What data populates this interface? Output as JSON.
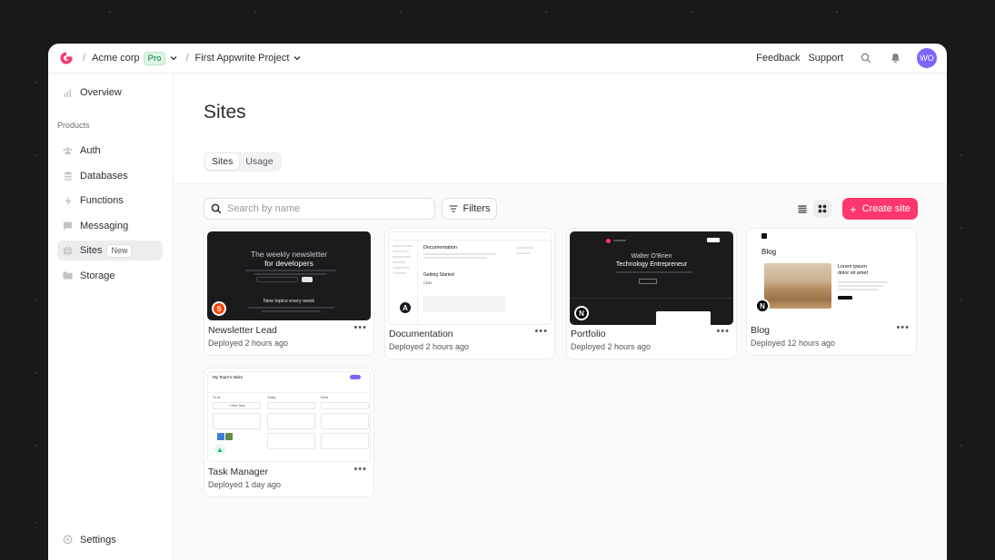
{
  "header": {
    "org_name": "Acme corp",
    "org_plan": "Pro",
    "project_name": "First Appwrite Project",
    "feedback_label": "Feedback",
    "support_label": "Support",
    "avatar_initials": "WO"
  },
  "sidebar": {
    "overview": "Overview",
    "section_products": "Products",
    "items": [
      {
        "label": "Auth",
        "icon": "users-icon"
      },
      {
        "label": "Databases",
        "icon": "database-icon"
      },
      {
        "label": "Functions",
        "icon": "lightning-icon"
      },
      {
        "label": "Messaging",
        "icon": "chat-icon"
      },
      {
        "label": "Sites",
        "icon": "globe-icon",
        "badge": "New",
        "active": true
      },
      {
        "label": "Storage",
        "icon": "folder-icon"
      }
    ],
    "settings": "Settings"
  },
  "page": {
    "title": "Sites",
    "tabs": [
      {
        "label": "Sites",
        "active": true
      },
      {
        "label": "Usage",
        "active": false
      }
    ],
    "search_placeholder": "Search by name",
    "filters_label": "Filters",
    "create_label": "Create site",
    "accent_color": "#fd366e"
  },
  "sites": [
    {
      "name": "Newsletter Lead",
      "deployed": "Deployed 2 hours ago",
      "framework_icon": "svelte-icon",
      "thumb": {
        "heading_1": "The weekly newsletter",
        "heading_2": "for developers",
        "sub": "New topics every week"
      }
    },
    {
      "name": "Documentation",
      "deployed": "Deployed 2 hours ago",
      "framework_icon": "astro-icon",
      "thumb": {
        "heading": "Documentation",
        "section": "Getting Started",
        "sub": "CDN"
      }
    },
    {
      "name": "Portfolio",
      "deployed": "Deployed 2 hours ago",
      "framework_icon": "nextjs-icon",
      "thumb": {
        "heading_1": "Walter O'Brien",
        "heading_2": "Technology Entrepreneur"
      }
    },
    {
      "name": "Blog",
      "deployed": "Deployed 12 hours ago",
      "framework_icon": "nextjs-icon",
      "thumb": {
        "heading": "Blog",
        "post_title_1": "Lorem ipsum",
        "post_title_2": "dolor sit amet"
      }
    },
    {
      "name": "Task Manager",
      "deployed": "Deployed 1 day ago",
      "framework_icon": "nuxt-icon",
      "thumb": {
        "heading": "My Team's tasks",
        "col_1": "To do",
        "col_2": "Today",
        "col_3": "Done",
        "new_task": "+ New Task"
      }
    }
  ]
}
